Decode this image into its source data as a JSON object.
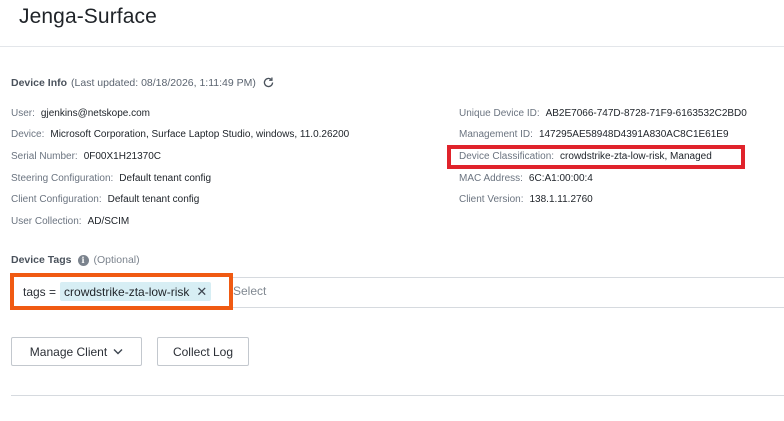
{
  "page": {
    "title": "Jenga-Surface"
  },
  "device_info": {
    "title": "Device Info",
    "last_updated": "(Last updated: 08/18/2026, 1:11:49 PM)",
    "refresh_icon": "refresh-icon",
    "left": [
      {
        "label": "User:",
        "value": "gjenkins@netskope.com"
      },
      {
        "label": "Device:",
        "value": "Microsoft Corporation, Surface Laptop Studio, windows, 11.0.26200"
      },
      {
        "label": "Serial Number:",
        "value": "0F00X1H21370C"
      },
      {
        "label": "Steering Configuration:",
        "value": "Default tenant config"
      },
      {
        "label": "Client Configuration:",
        "value": "Default tenant config"
      },
      {
        "label": "User Collection:",
        "value": "AD/SCIM"
      }
    ],
    "right": [
      {
        "label": "Unique Device ID:",
        "value": "AB2E7066-747D-8728-71F9-6163532C2BD0"
      },
      {
        "label": "Management ID:",
        "value": "147295AE58948D4391A830AC8C1E61E9"
      },
      {
        "label": "Device Classification:",
        "value": "crowdstrike-zta-low-risk, Managed"
      },
      {
        "label": "MAC Address:",
        "value": "6C:A1:00:00:4"
      },
      {
        "label": "Client Version:",
        "value": "138.1.11.2760"
      }
    ]
  },
  "device_tags": {
    "title": "Device Tags",
    "optional": "(Optional)",
    "key_label": "tags =",
    "chip_label": "crowdstrike-zta-low-risk",
    "placeholder": "Select"
  },
  "actions": {
    "manage_client": "Manage Client",
    "collect_log": "Collect Log"
  },
  "colors": {
    "highlight_orange": "#f05a12",
    "highlight_red": "#e0232b",
    "chip_bg": "#d7eef4"
  }
}
